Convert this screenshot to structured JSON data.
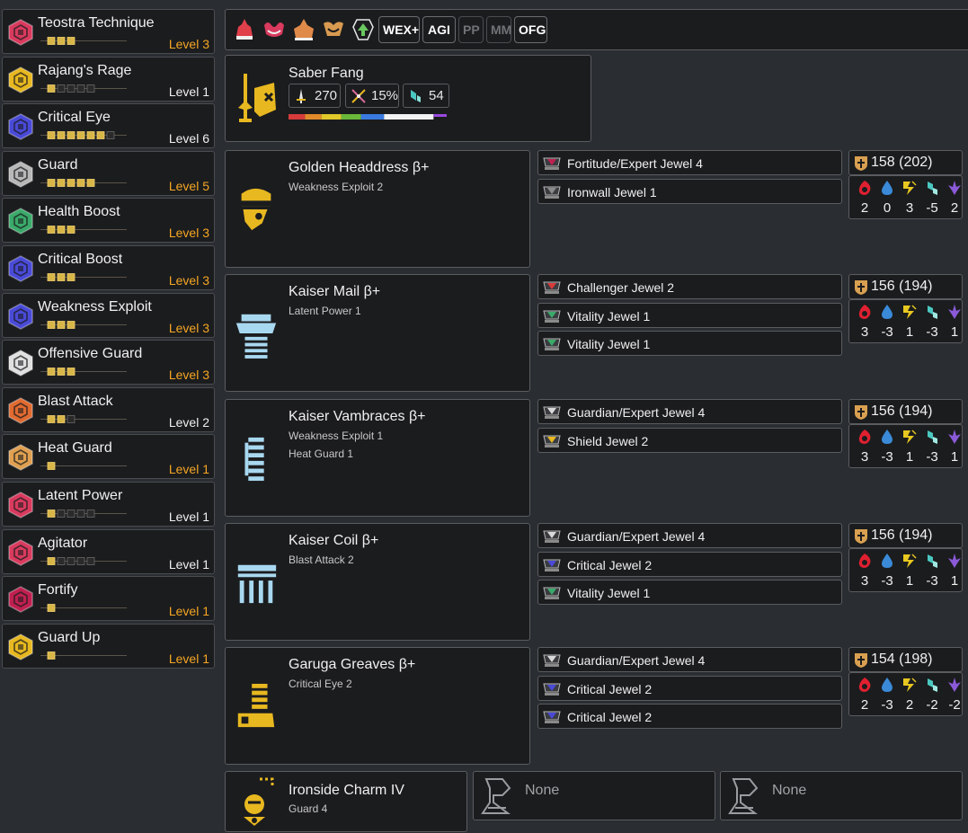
{
  "skills": [
    {
      "name": "Teostra Technique",
      "level_text": "Level 3",
      "level": 3,
      "max": 3,
      "maxed": true,
      "color": "#d93a5e"
    },
    {
      "name": "Rajang's Rage",
      "level_text": "Level 1",
      "level": 1,
      "max": 5,
      "maxed": false,
      "color": "#e8b820"
    },
    {
      "name": "Critical Eye",
      "level_text": "Level 6",
      "level": 6,
      "max": 7,
      "maxed": false,
      "color": "#4a4ad8"
    },
    {
      "name": "Guard",
      "level_text": "Level 5",
      "level": 5,
      "max": 5,
      "maxed": true,
      "color": "#b8b8b8"
    },
    {
      "name": "Health Boost",
      "level_text": "Level 3",
      "level": 3,
      "max": 3,
      "maxed": true,
      "color": "#3aaa6a"
    },
    {
      "name": "Critical Boost",
      "level_text": "Level 3",
      "level": 3,
      "max": 3,
      "maxed": true,
      "color": "#4a4ad8"
    },
    {
      "name": "Weakness Exploit",
      "level_text": "Level 3",
      "level": 3,
      "max": 3,
      "maxed": true,
      "color": "#4a4ad8"
    },
    {
      "name": "Offensive Guard",
      "level_text": "Level 3",
      "level": 3,
      "max": 3,
      "maxed": true,
      "color": "#e0e0e0"
    },
    {
      "name": "Blast Attack",
      "level_text": "Level 2",
      "level": 2,
      "max": 3,
      "maxed": false,
      "color": "#e06a30"
    },
    {
      "name": "Heat Guard",
      "level_text": "Level 1",
      "level": 1,
      "max": 1,
      "maxed": true,
      "color": "#e0a050"
    },
    {
      "name": "Latent Power",
      "level_text": "Level 1",
      "level": 1,
      "max": 5,
      "maxed": false,
      "color": "#d93a5e"
    },
    {
      "name": "Agitator",
      "level_text": "Level 1",
      "level": 1,
      "max": 5,
      "maxed": false,
      "color": "#d93a5e"
    },
    {
      "name": "Fortify",
      "level_text": "Level 1",
      "level": 1,
      "max": 1,
      "maxed": true,
      "color": "#c02050"
    },
    {
      "name": "Guard Up",
      "level_text": "Level 1",
      "level": 1,
      "max": 1,
      "maxed": true,
      "color": "#e8b820"
    }
  ],
  "toolbar": {
    "consumable_icons": [
      "might-seed-icon",
      "demon-drug-icon",
      "powertalon-icon",
      "powercharm-icon",
      "nulberry-icon"
    ],
    "buttons": [
      {
        "label": "WEX+",
        "enabled": true
      },
      {
        "label": "AGI",
        "enabled": true
      },
      {
        "label": "PP",
        "enabled": false
      },
      {
        "label": "MM",
        "enabled": false
      },
      {
        "label": "OFG",
        "enabled": true
      }
    ]
  },
  "weapon": {
    "name": "Saber Fang",
    "attack": "270",
    "affinity": "15%",
    "element": "54",
    "sharpness_colors": [
      "#d63b3b",
      "#e08a2a",
      "#e0c82a",
      "#6ab83a",
      "#3a7ae0",
      "#f2f2f2",
      "#9a4ae0"
    ],
    "sharpness_segments": [
      10,
      10,
      12,
      12,
      14,
      30,
      8
    ]
  },
  "armor": [
    {
      "name": "Golden Headdress β+",
      "skills": [
        "Weakness Exploit 2"
      ],
      "jewels": [
        {
          "name": "Fortitude/Expert Jewel 4",
          "color": "#c02050"
        },
        {
          "name": "Ironwall Jewel 1",
          "color": "#8a8a8a"
        }
      ],
      "defense": "158  (202)",
      "res": [
        "2",
        "0",
        "3",
        "-5",
        "2"
      ],
      "color": "#e8b820"
    },
    {
      "name": "Kaiser Mail β+",
      "skills": [
        "Latent Power 1"
      ],
      "jewels": [
        {
          "name": "Challenger Jewel 2",
          "color": "#d93a3a"
        },
        {
          "name": "Vitality Jewel 1",
          "color": "#3aaa6a"
        },
        {
          "name": "Vitality Jewel 1",
          "color": "#3aaa6a"
        }
      ],
      "defense": "156  (194)",
      "res": [
        "3",
        "-3",
        "1",
        "-3",
        "1"
      ],
      "color": "#a8d8f0"
    },
    {
      "name": "Kaiser Vambraces β+",
      "skills": [
        "Weakness Exploit 1",
        "Heat Guard 1"
      ],
      "jewels": [
        {
          "name": "Guardian/Expert Jewel 4",
          "color": "#d8d8d8"
        },
        {
          "name": "Shield Jewel 2",
          "color": "#e8b820"
        }
      ],
      "defense": "156  (194)",
      "res": [
        "3",
        "-3",
        "1",
        "-3",
        "1"
      ],
      "color": "#a8d8f0"
    },
    {
      "name": "Kaiser Coil β+",
      "skills": [
        "Blast Attack 2"
      ],
      "jewels": [
        {
          "name": "Guardian/Expert Jewel 4",
          "color": "#d8d8d8"
        },
        {
          "name": "Critical Jewel 2",
          "color": "#4a4ad8"
        },
        {
          "name": "Vitality Jewel 1",
          "color": "#3aaa6a"
        }
      ],
      "defense": "156  (194)",
      "res": [
        "3",
        "-3",
        "1",
        "-3",
        "1"
      ],
      "color": "#a8d8f0"
    },
    {
      "name": "Garuga Greaves β+",
      "skills": [
        "Critical Eye 2"
      ],
      "jewels": [
        {
          "name": "Guardian/Expert Jewel 4",
          "color": "#d8d8d8"
        },
        {
          "name": "Critical Jewel 2",
          "color": "#4a4ad8"
        },
        {
          "name": "Critical Jewel 2",
          "color": "#4a4ad8"
        }
      ],
      "defense": "154  (198)",
      "res": [
        "2",
        "-3",
        "2",
        "-2",
        "-2"
      ],
      "color": "#e8b820"
    }
  ],
  "charm": {
    "name": "Ironside Charm IV",
    "skill": "Guard 4"
  },
  "extra_slots": [
    {
      "label": "None"
    },
    {
      "label": "None"
    }
  ],
  "resistance_icons": [
    "fire-icon",
    "water-icon",
    "thunder-icon",
    "ice-icon",
    "dragon-icon"
  ]
}
